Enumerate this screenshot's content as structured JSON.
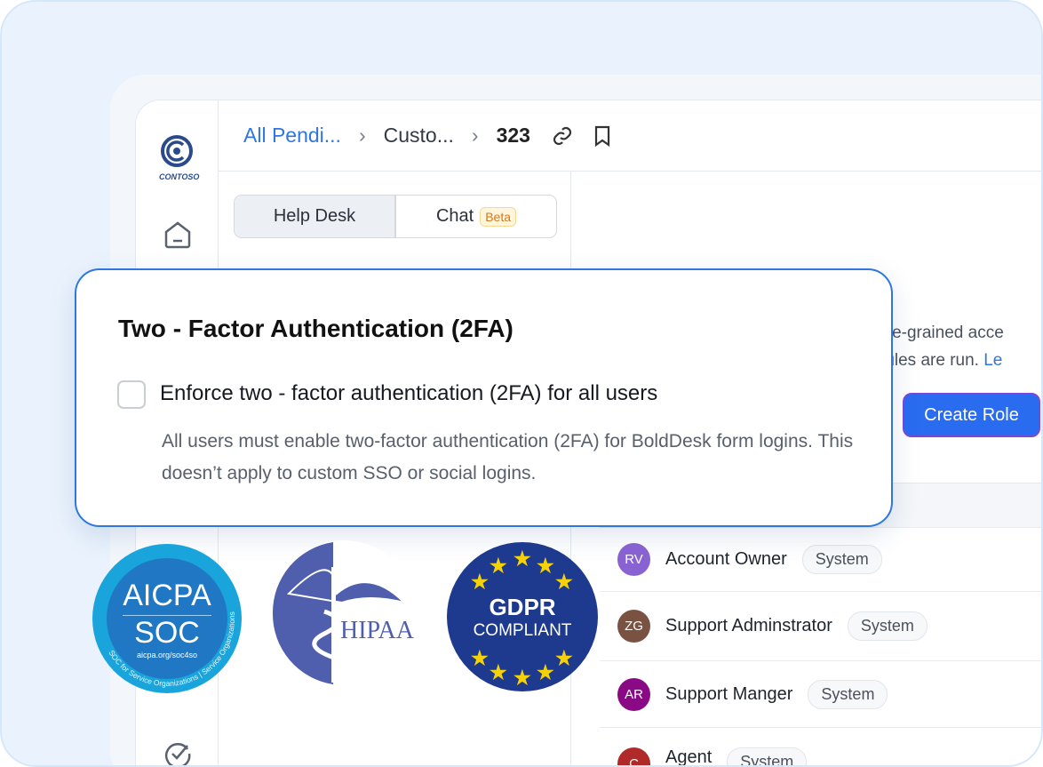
{
  "logo": {
    "text": "CONTOSO"
  },
  "breadcrumb": {
    "items": [
      "All Pendi...",
      "Custo...",
      "323"
    ]
  },
  "tabs": {
    "help_desk": "Help Desk",
    "chat": "Chat",
    "chat_badge": "Beta"
  },
  "roles_page": {
    "description_line1": "fine-grained acce",
    "description_line2": "rules are run.",
    "learn_link": "Le",
    "create_button": "Create Role"
  },
  "roles": [
    {
      "initials": "RV",
      "name": "Account Owner",
      "tag": "System",
      "color": "#8a63d2"
    },
    {
      "initials": "ZG",
      "name": "Support Adminstrator",
      "tag": "System",
      "color": "#7a5242"
    },
    {
      "initials": "AR",
      "name": "Support Manger",
      "tag": "System",
      "color": "#8a0a86"
    },
    {
      "initials": "C",
      "name": "Agent",
      "tag": "System",
      "color": "#b02a2a"
    }
  ],
  "modal": {
    "title": "Two - Factor Authentication (2FA)",
    "checkbox_label": "Enforce two - factor authentication (2FA) for all users",
    "checked": false,
    "description": "All users must enable two-factor authentication (2FA) for BoldDesk form logins. This doesn’t apply to custom SSO or social logins."
  },
  "badges": {
    "aicpa": {
      "line1": "AICPA",
      "line2": "SOC",
      "url": "aicpa.org/soc4so",
      "ring": "SOC for Service Organizations | Service Organizations"
    },
    "hipaa": {
      "text": "HIPAA"
    },
    "gdpr": {
      "line1": "GDPR",
      "line2": "COMPLIANT"
    }
  }
}
